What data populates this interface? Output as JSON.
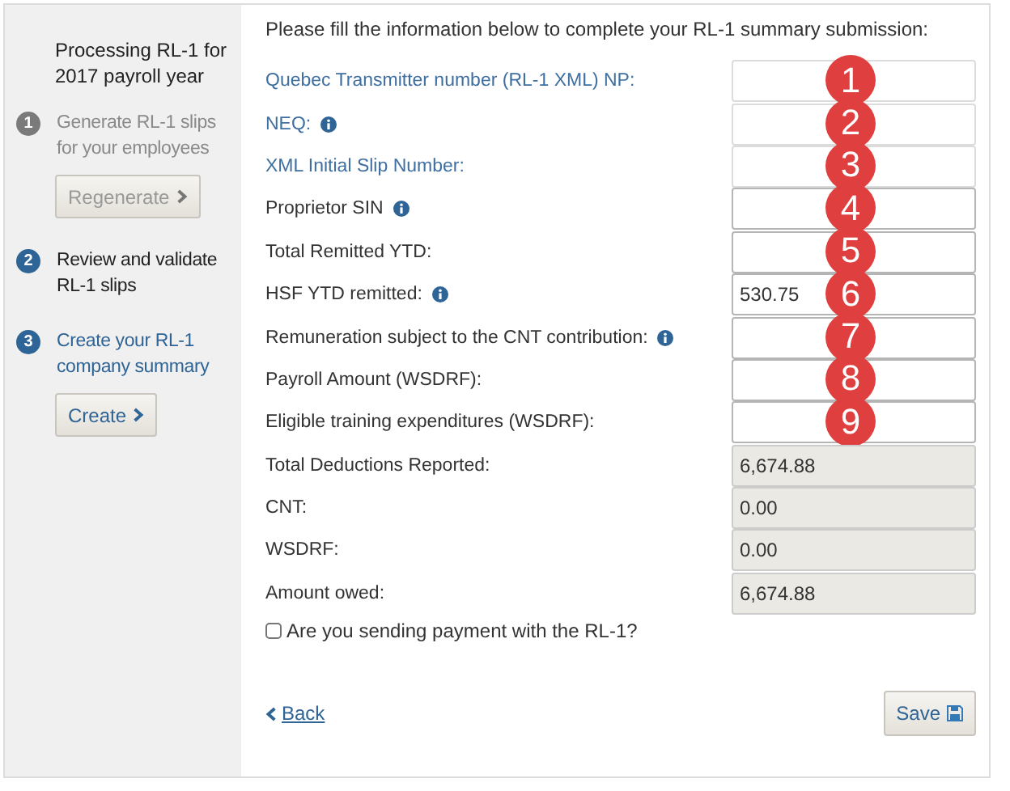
{
  "sidebar": {
    "title": "Processing RL-1 for 2017 payroll year",
    "steps": [
      {
        "number": "1",
        "label": "Generate RL-1 slips for your employees",
        "disabled": true,
        "selected": false,
        "button": "Regenerate"
      },
      {
        "number": "2",
        "label": "Review and validate RL-1 slips",
        "disabled": false,
        "selected": false
      },
      {
        "number": "3",
        "label": "Create your RL-1 company summary",
        "disabled": false,
        "selected": true,
        "button": "Create"
      }
    ]
  },
  "form": {
    "intro": "Please fill the information below to complete your RL-1 summary submission:",
    "fields": [
      {
        "label": "Quebec Transmitter number (RL-1 XML) NP:",
        "kind": "link",
        "info": false,
        "readonly": false,
        "badge": "1"
      },
      {
        "label": "NEQ:",
        "kind": "link",
        "info": true,
        "readonly": false,
        "badge": "2"
      },
      {
        "label": "XML Initial Slip Number:",
        "kind": "link",
        "info": false,
        "readonly": false,
        "badge": "3"
      },
      {
        "label": "Proprietor SIN",
        "kind": "plain",
        "info": true,
        "readonly": false,
        "badge": "4"
      },
      {
        "label": "Total Remitted YTD:",
        "kind": "plain",
        "info": false,
        "readonly": false,
        "badge": "5"
      },
      {
        "label": "HSF YTD remitted:",
        "kind": "plain",
        "info": true,
        "readonly": false,
        "value": "530.75",
        "badge": "6"
      },
      {
        "label": "Remuneration subject to the CNT contribution:",
        "kind": "plain",
        "info": true,
        "readonly": false,
        "badge": "7"
      },
      {
        "label": "Payroll Amount (WSDRF):",
        "kind": "plain",
        "info": false,
        "readonly": false,
        "badge": "8"
      },
      {
        "label": "Eligible training expenditures (WSDRF):",
        "kind": "plain",
        "info": false,
        "readonly": false,
        "badge": "9"
      },
      {
        "label": "Total Deductions Reported:",
        "kind": "plain",
        "info": false,
        "readonly": true,
        "value": "6,674.88"
      },
      {
        "label": "CNT:",
        "kind": "plain",
        "info": false,
        "readonly": true,
        "value": "0.00"
      },
      {
        "label": "WSDRF:",
        "kind": "plain",
        "info": false,
        "readonly": true,
        "value": "0.00"
      },
      {
        "label": "Amount owed:",
        "kind": "plain",
        "info": false,
        "readonly": true,
        "value": "6,674.88"
      }
    ],
    "payment_checkbox": {
      "label": "Are you sending payment with the RL-1?",
      "checked": false
    },
    "back_link": "Back",
    "save_button": "Save"
  }
}
